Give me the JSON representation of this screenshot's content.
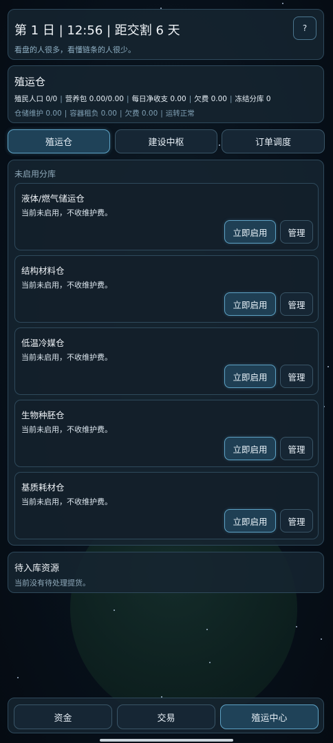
{
  "header": {
    "title": "第 1 日 | 12:56 | 距交割 6 天",
    "subtitle": "看盘的人很多，看懂链条的人很少。",
    "help_label": "?"
  },
  "status": {
    "name": "殖运仓",
    "line1": [
      "殖民人口 0/0",
      "营养包 0.00/0.00",
      "每日净收支 0.00",
      "欠费 0.00",
      "冻结分库 0"
    ],
    "line2": [
      "仓储维护 0.00",
      "容器租负 0.00",
      "欠费 0.00",
      "运转正常"
    ]
  },
  "tabs": [
    {
      "label": "殖运仓",
      "active": true
    },
    {
      "label": "建设中枢",
      "active": false
    },
    {
      "label": "订单调度",
      "active": false
    }
  ],
  "warehouses": {
    "section_label": "未启用分库",
    "items": [
      {
        "name": "液体/燃气储运仓",
        "status": "当前未启用，不收维护费。",
        "enable_label": "立即启用",
        "manage_label": "管理"
      },
      {
        "name": "结构材料仓",
        "status": "当前未启用，不收维护费。",
        "enable_label": "立即启用",
        "manage_label": "管理"
      },
      {
        "name": "低温冷媒仓",
        "status": "当前未启用，不收维护费。",
        "enable_label": "立即启用",
        "manage_label": "管理"
      },
      {
        "name": "生物种胚仓",
        "status": "当前未启用，不收维护费。",
        "enable_label": "立即启用",
        "manage_label": "管理"
      },
      {
        "name": "基质耗材仓",
        "status": "当前未启用，不收维护费。",
        "enable_label": "立即启用",
        "manage_label": "管理"
      }
    ]
  },
  "pending": {
    "title": "待入库资源",
    "description": "当前没有待处理提货。"
  },
  "bottom_nav": [
    {
      "label": "资金",
      "active": false
    },
    {
      "label": "交易",
      "active": false
    },
    {
      "label": "殖运中心",
      "active": true
    }
  ]
}
